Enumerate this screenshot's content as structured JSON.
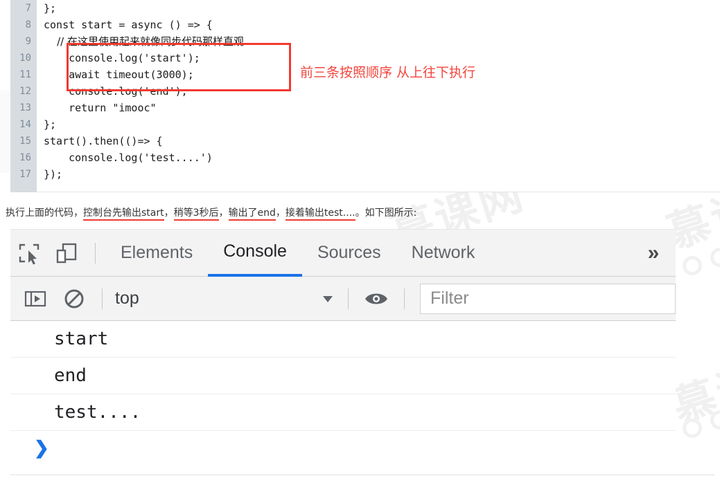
{
  "code_block": {
    "lines": [
      {
        "number": "7",
        "text": "};",
        "cjk": false
      },
      {
        "number": "8",
        "text": "const start = async () => {",
        "cjk": false
      },
      {
        "number": "9",
        "text": "    // 在这里使用起来就像同步代码那样直观",
        "cjk": true
      },
      {
        "number": "10",
        "text": "    console.log('start');",
        "cjk": false
      },
      {
        "number": "11",
        "text": "    await timeout(3000);",
        "cjk": false
      },
      {
        "number": "12",
        "text": "    console.log('end');",
        "cjk": false
      },
      {
        "number": "13",
        "text": "    return \"imooc\"",
        "cjk": false
      },
      {
        "number": "14",
        "text": "};",
        "cjk": false
      },
      {
        "number": "15",
        "text": "start().then(()=> {",
        "cjk": false
      },
      {
        "number": "16",
        "text": "    console.log('test....')",
        "cjk": false
      },
      {
        "number": "17",
        "text": "});",
        "cjk": false
      }
    ],
    "annotation": "前三条按照顺序 从上往下执行",
    "highlight_color": "#f23a30",
    "annotation_color": "#f4453c"
  },
  "paragraph": {
    "part1": "执行上面的代码，",
    "underline1": "控制台先输出start",
    "part2": "，",
    "underline2": "稍等3秒后",
    "part3": "，",
    "underline3": "输出了end",
    "part4": "，",
    "underline4": "接着输出test....",
    "part5": "。如下图所示:",
    "underline_color": "#ef3b32"
  },
  "devtools": {
    "toolbar": {
      "inspect_icon": "inspect-element-icon",
      "device_icon": "device-toolbar-icon",
      "tabs": [
        {
          "label": "Elements",
          "active": false
        },
        {
          "label": "Console",
          "active": true
        },
        {
          "label": "Sources",
          "active": false
        },
        {
          "label": "Network",
          "active": false
        }
      ],
      "overflow_label": "»",
      "active_tab_color": "#1a73e8"
    },
    "subbar": {
      "sidebar_icon": "console-sidebar-toggle-icon",
      "clear_icon": "clear-console-icon",
      "context_value": "top",
      "caret_icon": "chevron-down-icon",
      "eye_icon": "eye-icon",
      "filter_placeholder": "Filter"
    },
    "console_messages": [
      {
        "text": "start"
      },
      {
        "text": "end"
      },
      {
        "text": "test...."
      }
    ],
    "prompt_caret": "❯"
  },
  "watermarks": {
    "text_a": "慕课网",
    "text_b": "慕课",
    "text_c": "慕课"
  }
}
